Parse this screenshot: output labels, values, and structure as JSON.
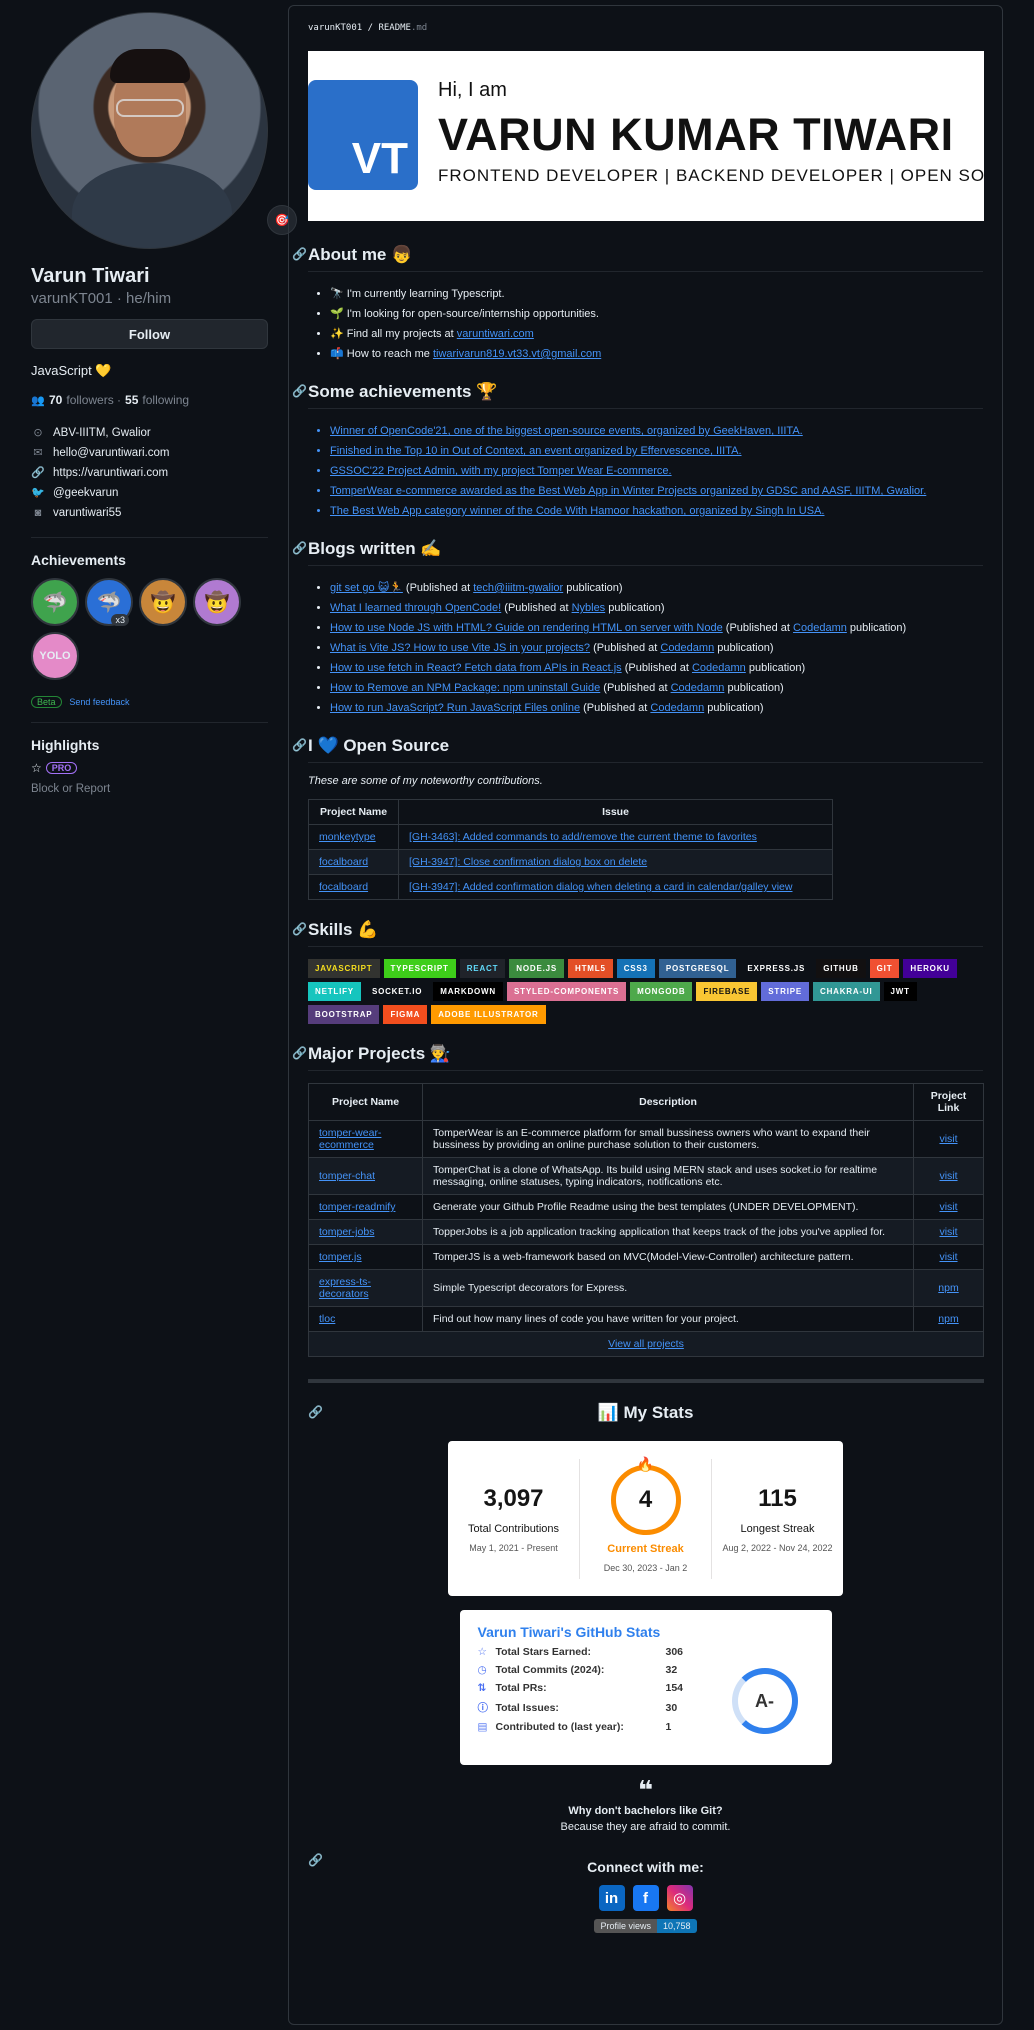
{
  "profile": {
    "name": "Varun Tiwari",
    "handle": "varunKT001 · he/him",
    "follow_label": "Follow",
    "bio": "JavaScript 💛",
    "followers": "70",
    "followers_label": "followers ·",
    "following": "55",
    "following_label": "following",
    "location": "ABV-IIITM, Gwalior",
    "email": "hello@varuntiwari.com",
    "website": "https://varuntiwari.com",
    "twitter": "@geekvarun",
    "other": "varuntiwari55",
    "status_emoji": "🎯"
  },
  "achievements": {
    "title": "Achievements",
    "badges": [
      "🦈",
      "🦈",
      "🤠",
      "🤠",
      "YOLO"
    ],
    "x3": "x3",
    "beta": "Beta",
    "feedback": "Send feedback"
  },
  "highlights": {
    "title": "Highlights",
    "pro": "PRO",
    "block": "Block or Report"
  },
  "readme": {
    "crumb_user": "varunKT001",
    "crumb_sep": "/",
    "crumb_file": "README",
    "crumb_ext": ".md",
    "banner": {
      "initials": "VT",
      "hi": "Hi, I am",
      "name": "VARUN KUMAR TIWARI",
      "roles": "FRONTEND DEVELOPER  |  BACKEND DEVELOPER  |  OPEN SOURCE"
    },
    "about_title": "About me 👦",
    "about": [
      {
        "text": "🔭 I'm currently learning Typescript.",
        "link": ""
      },
      {
        "text": "🌱 I'm looking for open-source/internship opportunities.",
        "link": ""
      },
      {
        "text": "✨ Find all my projects at ",
        "link": "varuntiwari.com"
      },
      {
        "text": "📫 How to reach me ",
        "link": "tiwarivarun819.vt33.vt@gmail.com"
      }
    ],
    "ach_title": "Some achievements 🏆",
    "ach": [
      "Winner of OpenCode'21, one of the biggest open-source events, organized by GeekHaven, IIITA.",
      "Finished in the Top 10 in Out of Context, an event organized by Effervescence, IIITA.",
      "GSSOC'22 Project Admin, with my project Tomper Wear E-commerce.",
      "TomperWear e-commerce awarded as the Best Web App in Winter Projects organized by GDSC and AASF, IIITM, Gwalior.",
      "The Best Web App category winner of the Code With Hamoor hackathon, organized by Singh In USA."
    ],
    "blogs_title": "Blogs written ✍️",
    "blogs": [
      {
        "title": "git set go 😺🏃",
        "pre": " (Published at ",
        "pub": "tech@iiitm-gwalior",
        "post": " publication)"
      },
      {
        "title": "What I learned through OpenCode!",
        "pre": " (Published at ",
        "pub": "Nybles",
        "post": " publication)"
      },
      {
        "title": "How to use Node JS with HTML? Guide on rendering HTML on server with Node",
        "pre": " (Published at ",
        "pub": "Codedamn",
        "post": " publication)"
      },
      {
        "title": "What is Vite JS? How to use Vite JS in your projects?",
        "pre": " (Published at ",
        "pub": "Codedamn",
        "post": " publication)"
      },
      {
        "title": "How to use fetch in React? Fetch data from APIs in React.js",
        "pre": " (Published at ",
        "pub": "Codedamn",
        "post": " publication)"
      },
      {
        "title": "How to Remove an NPM Package: npm uninstall Guide",
        "pre": " (Published at ",
        "pub": "Codedamn",
        "post": " publication)"
      },
      {
        "title": "How to run JavaScript? Run JavaScript Files online",
        "pre": " (Published at ",
        "pub": "Codedamn",
        "post": " publication)"
      }
    ],
    "os_title": "I 💙 Open Source",
    "os_intro": "These are some of my noteworthy contributions.",
    "os_headers": [
      "Project Name",
      "Issue"
    ],
    "os_rows": [
      [
        "monkeytype",
        "[GH-3463]: Added commands to add/remove the current theme to favorites"
      ],
      [
        "focalboard",
        "[GH-3947]: Close confirmation dialog box on delete"
      ],
      [
        "focalboard",
        "[GH-3947]: Added confirmation dialog when deleting a card in calendar/galley view"
      ]
    ],
    "skills_title": "Skills 💪",
    "skills": [
      {
        "label": "JAVASCRIPT",
        "color": "#323330",
        "fg": "#F7DF1E"
      },
      {
        "label": "TYPESCRIPT",
        "color": "#3ECE1A",
        "fg": "#fff"
      },
      {
        "label": "REACT",
        "color": "#20232a",
        "fg": "#61DAFB"
      },
      {
        "label": "NODE.JS",
        "color": "#3b8b3e",
        "fg": "#fff"
      },
      {
        "label": "HTML5",
        "color": "#E34F26",
        "fg": "#fff"
      },
      {
        "label": "CSS3",
        "color": "#1572B6",
        "fg": "#fff"
      },
      {
        "label": "POSTGRESQL",
        "color": "#316192",
        "fg": "#fff"
      },
      {
        "label": "EXPRESS.JS",
        "color": "#0d1117",
        "fg": "#fff"
      },
      {
        "label": "GITHUB",
        "color": "#121011",
        "fg": "#fff"
      },
      {
        "label": "GIT",
        "color": "#F05032",
        "fg": "#fff"
      },
      {
        "label": "HEROKU",
        "color": "#430098",
        "fg": "#fff"
      },
      {
        "label": "NETLIFY",
        "color": "#16C5BE",
        "fg": "#fff"
      },
      {
        "label": "SOCKET.IO",
        "color": "#0d1117",
        "fg": "#fff"
      },
      {
        "label": "MARKDOWN",
        "color": "#000000",
        "fg": "#fff"
      },
      {
        "label": "STYLED-COMPONENTS",
        "color": "#DB7093",
        "fg": "#fff"
      },
      {
        "label": "MONGODB",
        "color": "#4ea94b",
        "fg": "#fff"
      },
      {
        "label": "FIREBASE",
        "color": "#F9C633",
        "fg": "#111"
      },
      {
        "label": "STRIPE",
        "color": "#626CD9",
        "fg": "#fff"
      },
      {
        "label": "CHAKRA-UI",
        "color": "#319795",
        "fg": "#fff"
      },
      {
        "label": "JWT",
        "color": "#000000",
        "fg": "#fff"
      },
      {
        "label": "BOOTSTRAP",
        "color": "#563D7C",
        "fg": "#fff"
      },
      {
        "label": "FIGMA",
        "color": "#F24E1E",
        "fg": "#fff"
      },
      {
        "label": "ADOBE ILLUSTRATOR",
        "color": "#FF9A00",
        "fg": "#fff"
      }
    ],
    "projects_title": "Major Projects 👨‍🏭",
    "proj_headers": [
      "Project Name",
      "Description",
      "Project Link"
    ],
    "projects": [
      {
        "name": "tomper-wear-ecommerce",
        "desc": "TomperWear is an E-commerce platform for small bussiness owners who want to expand their bussiness by providing an online purchase solution to their customers.",
        "link": "visit"
      },
      {
        "name": "tomper-chat",
        "desc": "TomperChat is a clone of WhatsApp. Its build using MERN stack and uses socket.io for realtime messaging, online statuses, typing indicators, notifications etc.",
        "link": "visit"
      },
      {
        "name": "tomper-readmify",
        "desc": "Generate your Github Profile Readme using the best templates (UNDER DEVELOPMENT).",
        "link": "visit"
      },
      {
        "name": "tomper-jobs",
        "desc": "TopperJobs is a job application tracking application that keeps track of the jobs you've applied for.",
        "link": "visit"
      },
      {
        "name": "tomper.js",
        "desc": "TomperJS is a web-framework based on MVC(Model-View-Controller) architecture pattern.",
        "link": "visit"
      },
      {
        "name": "express-ts-decorators",
        "desc": "Simple Typescript decorators for Express.",
        "link": "npm"
      },
      {
        "name": "tloc",
        "desc": "Find out how many lines of code you have written for your project.",
        "link": "npm"
      }
    ],
    "view_all": "View all projects",
    "stats_title": "📊 My Stats",
    "streak": {
      "total": "3,097",
      "total_label": "Total Contributions",
      "total_range": "May 1, 2021 - Present",
      "current": "4",
      "current_label": "Current Streak",
      "current_range": "Dec 30, 2023 - Jan 2",
      "longest": "115",
      "longest_label": "Longest Streak",
      "longest_range": "Aug 2, 2022 - Nov 24, 2022"
    },
    "gh": {
      "title": "Varun Tiwari's GitHub Stats",
      "rows": [
        {
          "icon": "☆",
          "k": "Total Stars Earned:",
          "v": "306"
        },
        {
          "icon": "◷",
          "k": "Total Commits (2024):",
          "v": "32"
        },
        {
          "icon": "⇅",
          "k": "Total PRs:",
          "v": "154"
        },
        {
          "icon": "ⓘ",
          "k": "Total Issues:",
          "v": "30"
        },
        {
          "icon": "▤",
          "k": "Contributed to (last year):",
          "v": "1"
        }
      ],
      "grade": "A-"
    },
    "quote_mark": "❝",
    "quote_q": "Why don't bachelors like Git?",
    "quote_a": "Because they are afraid to commit.",
    "connect": "Connect with me:",
    "pv_label": "Profile views",
    "pv_value": "10,758"
  }
}
